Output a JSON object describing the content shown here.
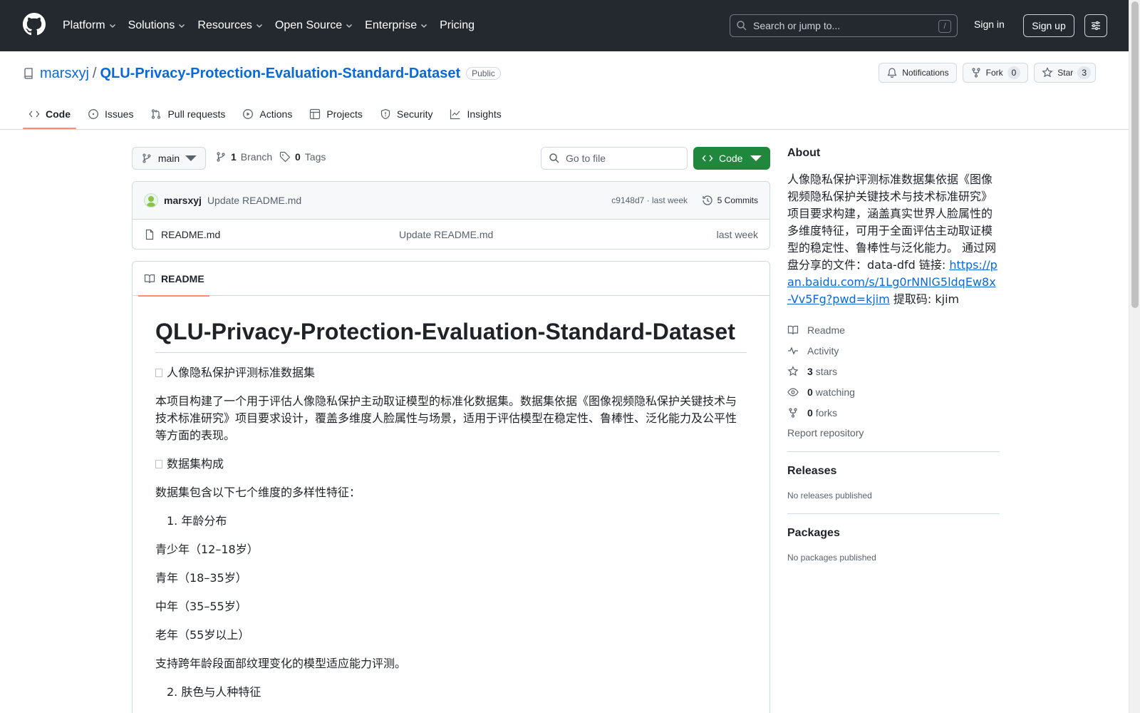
{
  "header": {
    "nav": [
      "Platform",
      "Solutions",
      "Resources",
      "Open Source",
      "Enterprise",
      "Pricing"
    ],
    "search_placeholder": "Search or jump to...",
    "search_hotkey": "/",
    "signin": "Sign in",
    "signup": "Sign up"
  },
  "repo": {
    "owner": "marsxyj",
    "separator": "/",
    "name": "QLU-Privacy-Protection-Evaluation-Standard-Dataset",
    "visibility": "Public",
    "notifications_label": "Notifications",
    "fork_label": "Fork",
    "fork_count": "0",
    "star_label": "Star",
    "star_count": "3"
  },
  "tabs": [
    {
      "label": "Code",
      "icon": "code-icon",
      "selected": true
    },
    {
      "label": "Issues",
      "icon": "issue-icon"
    },
    {
      "label": "Pull requests",
      "icon": "pull-request-icon"
    },
    {
      "label": "Actions",
      "icon": "play-icon"
    },
    {
      "label": "Projects",
      "icon": "table-icon"
    },
    {
      "label": "Security",
      "icon": "shield-icon"
    },
    {
      "label": "Insights",
      "icon": "graph-icon"
    }
  ],
  "filenav": {
    "branch": "main",
    "branch_count": "1",
    "branch_label": "Branch",
    "tag_count": "0",
    "tag_label": "Tags",
    "goto_placeholder": "Go to file",
    "code_button": "Code"
  },
  "commit": {
    "author": "marsxyj",
    "message": "Update README.md",
    "meta": "c9148d7 · last week",
    "commits": "5 Commits"
  },
  "files": [
    {
      "name": "README.md",
      "commit": "Update README.md",
      "date": "last week"
    }
  ],
  "readme": {
    "tab": "README",
    "title": "QLU-Privacy-Protection-Evaluation-Standard-Dataset",
    "subtitle": "人像隐私保护评测标准数据集",
    "intro": "本项目构建了一个用于评估人像隐私保护主动取证模型的标准化数据集。数据集依据《图像视频隐私保护关键技术与技术标准研究》项目要求设计，覆盖多维度人脸属性与场景，适用于评估模型在稳定性、鲁棒性、泛化能力及公平性等方面的表现。",
    "section1": "数据集构成",
    "section1_desc": "数据集包含以下七个维度的多样性特征：",
    "item1": "1. 年龄分布",
    "ages": [
      "青少年（12–18岁）",
      "青年（18–35岁）",
      "中年（35–55岁）",
      "老年（55岁以上）"
    ],
    "age_note": "支持跨年龄段面部纹理变化的模型适应能力评测。",
    "item2": "2. 肤色与人种特征"
  },
  "about": {
    "heading": "About",
    "text": "人像隐私保护评测标准数据集依据《图像视频隐私保护关键技术与技术标准研究》项目要求构建，涵盖真实世界人脸属性的多维度特征，可用于全面评估主动取证模型的稳定性、鲁棒性与泛化能力。 通过网盘分享的文件：data-dfd 链接: ",
    "link": "https://pan.baidu.com/s/1Lg0rNNlG5ldqEw8x-Vv5Fg?pwd=kjim",
    "code_text": " 提取码: kjim",
    "readme": "Readme",
    "activity": "Activity",
    "stars_count": "3",
    "stars_label": "stars",
    "watching_count": "0",
    "watching_label": "watching",
    "forks_count": "0",
    "forks_label": "forks",
    "report": "Report repository"
  },
  "releases": {
    "heading": "Releases",
    "text": "No releases published"
  },
  "packages": {
    "heading": "Packages",
    "text": "No packages published"
  },
  "colors": {
    "header_bg": "#24292f",
    "link": "#0969da",
    "code_button": "#1f883d",
    "tab_underline": "#fd8c73"
  }
}
